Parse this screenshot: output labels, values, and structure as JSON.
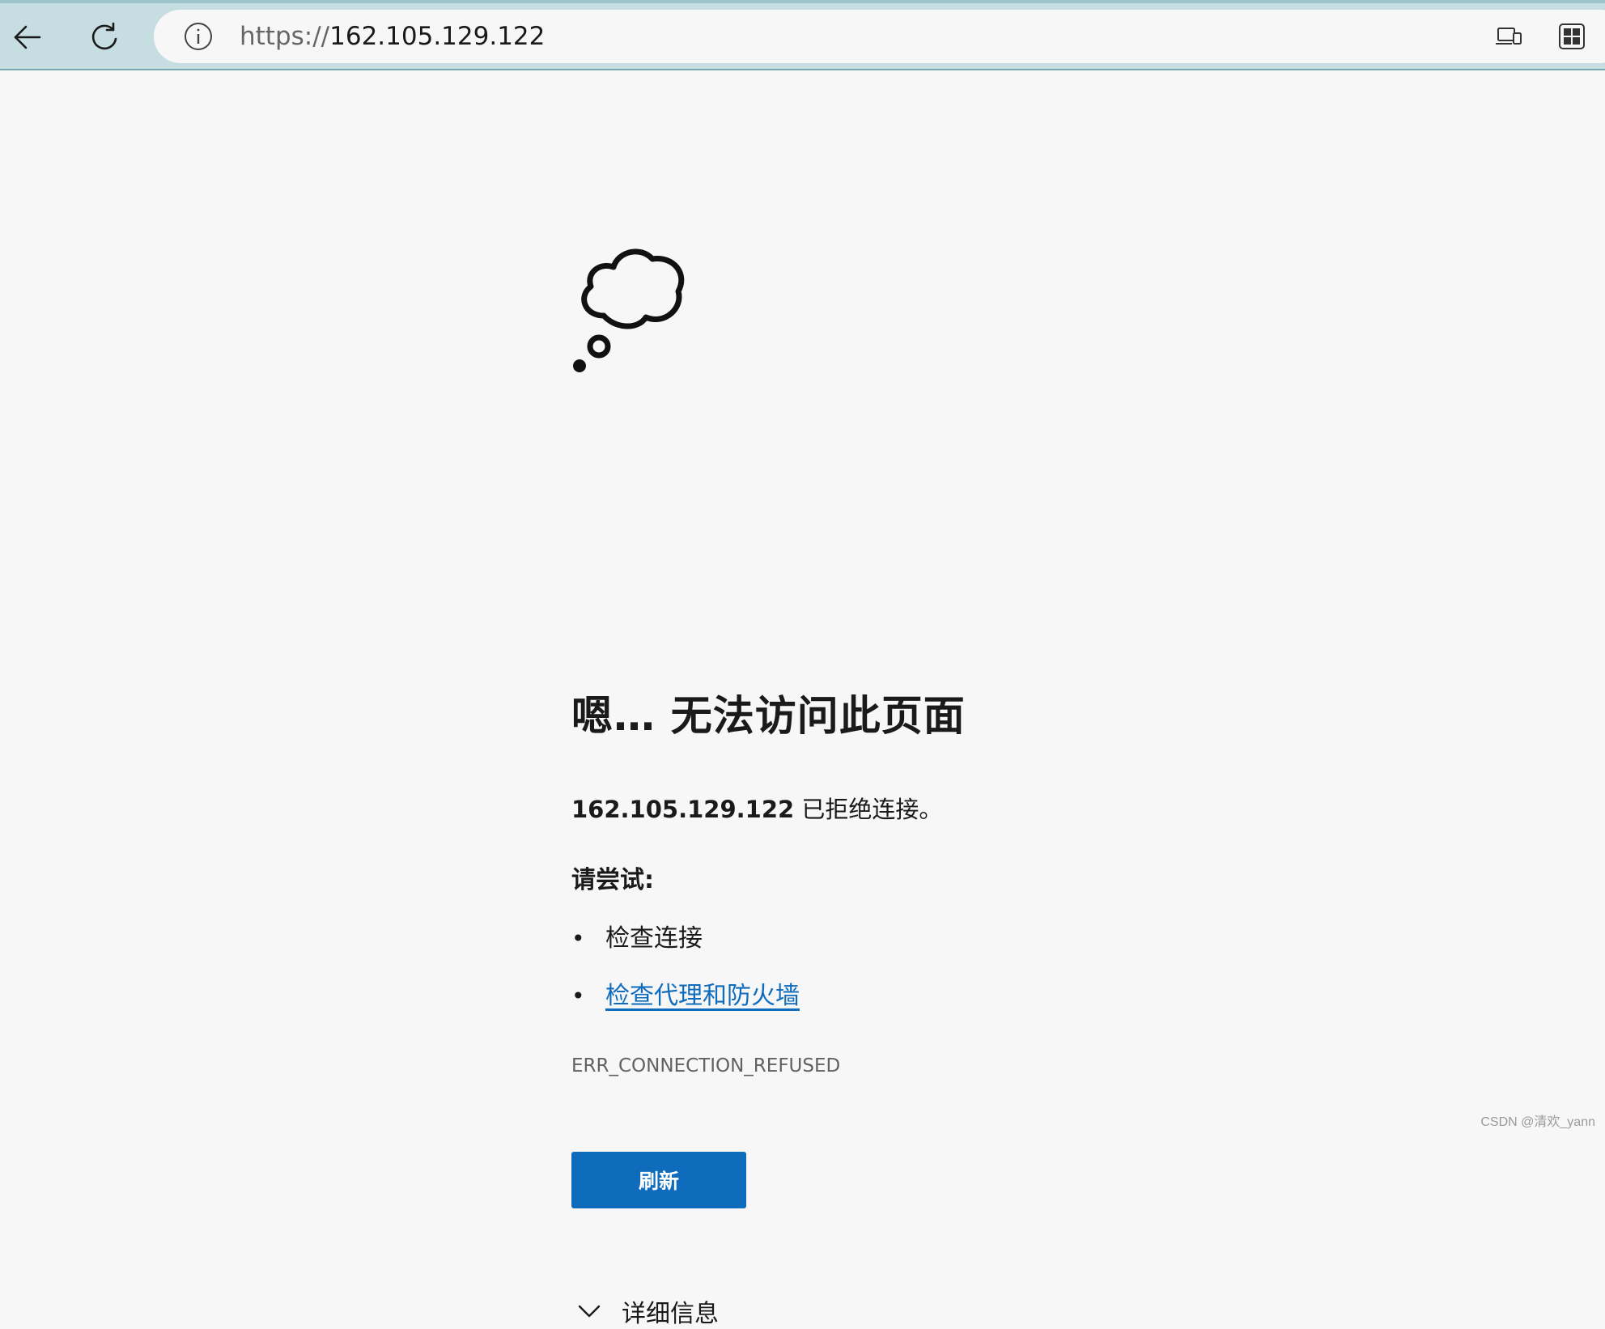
{
  "browser": {
    "url_scheme": "https://",
    "url_host": "162.105.129.122"
  },
  "error_page": {
    "title": "嗯… 无法访问此页面",
    "refused_host": "162.105.129.122",
    "refused_message": " 已拒绝连接。",
    "try_heading": "请尝试:",
    "suggestions": [
      {
        "text": "检查连接",
        "is_link": false
      },
      {
        "text": "检查代理和防火墙",
        "is_link": true
      }
    ],
    "bullet": "•",
    "error_code": "ERR_CONNECTION_REFUSED",
    "refresh_label": "刷新",
    "details_label": "详细信息"
  },
  "watermark": "CSDN @清欢_yann",
  "icons": {
    "back": "back-arrow-icon",
    "reload": "reload-icon",
    "site_info": "info-icon",
    "app_available": "app-available-icon",
    "apps_grid": "apps-grid-icon",
    "illustration": "thought-cloud-icon",
    "details_toggle": "chevron-down-icon"
  },
  "colors": {
    "toolbar": "#c6dde2",
    "page_background": "#f7f7f7",
    "accent": "#0f6cbd",
    "error_code_text": "#616161"
  }
}
